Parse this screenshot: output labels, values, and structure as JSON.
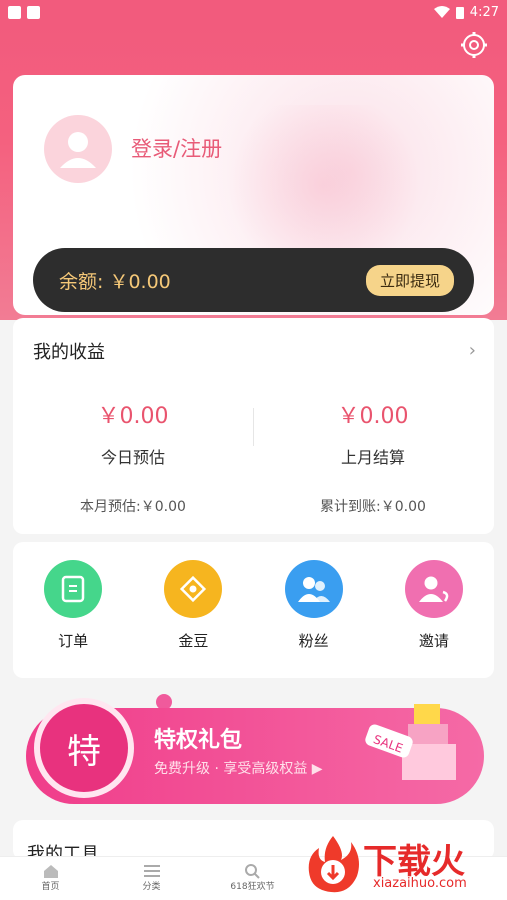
{
  "status": {
    "time": "4:27"
  },
  "profile": {
    "login_label": "登录/注册"
  },
  "balance": {
    "text": "余额: ￥0.00",
    "withdraw_label": "立即提现"
  },
  "earnings": {
    "title": "我的收益",
    "today": {
      "amount": "￥0.00",
      "label": "今日预估"
    },
    "last_month": {
      "amount": "￥0.00",
      "label": "上月结算"
    },
    "month_estimate": "本月预估:￥0.00",
    "total_received": "累计到账:￥0.00"
  },
  "shortcuts": [
    {
      "label": "订单",
      "icon": "order-icon",
      "color": "#45d68b"
    },
    {
      "label": "金豆",
      "icon": "gold-bean-icon",
      "color": "#f6b51f"
    },
    {
      "label": "粉丝",
      "icon": "fans-icon",
      "color": "#3a9ef0"
    },
    {
      "label": "邀请",
      "icon": "invite-icon",
      "color": "#f06fb0"
    }
  ],
  "banner": {
    "badge": "特",
    "title": "特权礼包",
    "subtitle": "免费升级 · 享受高级权益 ▶",
    "sale_tag": "SALE"
  },
  "tools": {
    "title": "我的工具"
  },
  "bottom_nav": [
    {
      "label": "首页",
      "icon": "home-icon"
    },
    {
      "label": "分类",
      "icon": "list-icon"
    },
    {
      "label": "618狂欢节",
      "icon": "search-icon"
    }
  ],
  "watermark": {
    "title": "下载火",
    "url": "xiazaihuo.com"
  }
}
